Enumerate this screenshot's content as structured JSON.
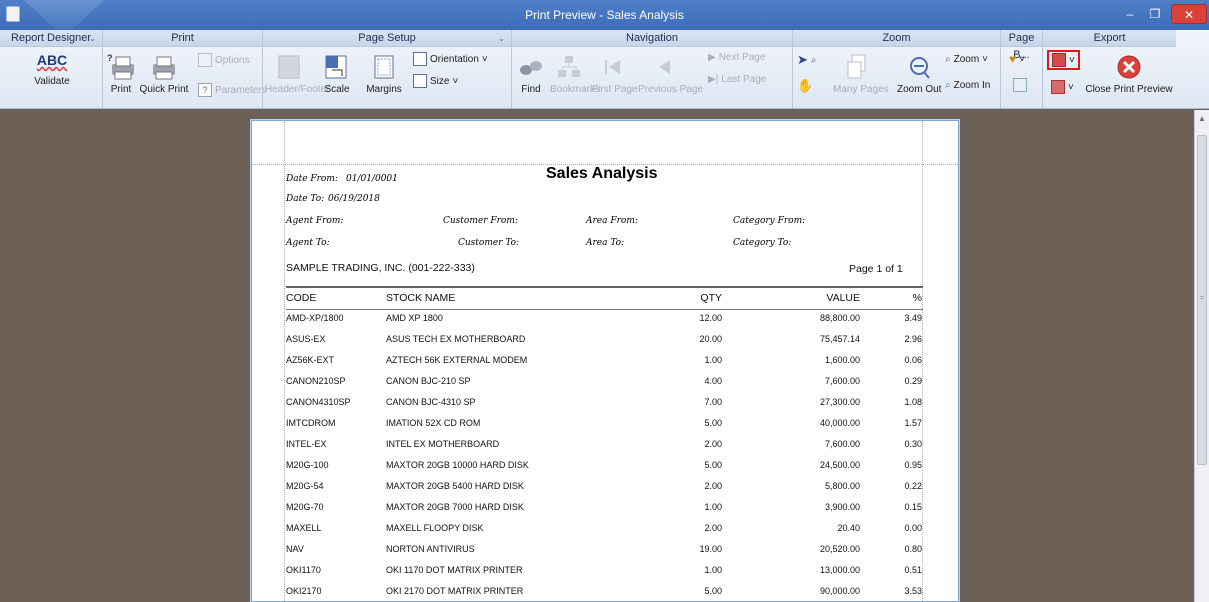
{
  "window": {
    "title": "Print Preview - Sales Analysis"
  },
  "ribbon": {
    "groups": {
      "report_designer": "Report Designer",
      "print": "Print",
      "page_setup": "Page Setup",
      "navigation": "Navigation",
      "zoom": "Zoom",
      "page_background": "Page B...",
      "export": "Export"
    },
    "validate_abc": "ABC",
    "validate": "Validate",
    "print": "Print",
    "quick_print": "Quick Print",
    "options": "Options",
    "parameters": "Parameters",
    "header_footer": "Header/Footer",
    "scale": "Scale",
    "margins": "Margins",
    "orientation": "Orientation",
    "size": "Size",
    "find": "Find",
    "bookmarks": "Bookmarks",
    "first_page": "First Page",
    "previous_page": "Previous Page",
    "next_page": "Next Page",
    "last_page": "Last Page",
    "many_pages": "Many Pages",
    "zoom_out": "Zoom Out",
    "zoom": "Zoom",
    "zoom_in": "Zoom In",
    "close_print_preview": "Close Print Preview"
  },
  "report": {
    "title": "Sales Analysis",
    "date_from_label": "Date From:",
    "date_from": "01/01/0001",
    "date_to_label": "Date To:",
    "date_to": "06/19/2018",
    "agent_from": "Agent From:",
    "agent_to": "Agent To:",
    "customer_from": "Customer From:",
    "customer_to": "Customer To:",
    "area_from": "Area From:",
    "area_to": "Area To:",
    "category_from": "Category From:",
    "category_to": "Category To:",
    "company": "SAMPLE TRADING, INC. (001-222-333)",
    "page_number": "Page 1 of 1",
    "columns": {
      "code": "CODE",
      "stock_name": "STOCK NAME",
      "qty": "QTY",
      "value": "VALUE",
      "pct": "%"
    },
    "rows": [
      {
        "code": "AMD-XP/1800",
        "name": "AMD XP 1800",
        "qty": "12.00",
        "value": "88,800.00",
        "pct": "3.49"
      },
      {
        "code": "ASUS-EX",
        "name": "ASUS TECH EX MOTHERBOARD",
        "qty": "20.00",
        "value": "75,457.14",
        "pct": "2.96"
      },
      {
        "code": "AZ56K-EXT",
        "name": "AZTECH 56K EXTERNAL MODEM",
        "qty": "1.00",
        "value": "1,600.00",
        "pct": "0.06"
      },
      {
        "code": "CANON210SP",
        "name": "CANON BJC-210 SP",
        "qty": "4.00",
        "value": "7,600.00",
        "pct": "0.29"
      },
      {
        "code": "CANON4310SP",
        "name": "CANON BJC-4310 SP",
        "qty": "7.00",
        "value": "27,300.00",
        "pct": "1.08"
      },
      {
        "code": "IMTCDROM",
        "name": "IMATION 52X CD ROM",
        "qty": "5.00",
        "value": "40,000.00",
        "pct": "1.57"
      },
      {
        "code": "INTEL-EX",
        "name": "INTEL EX MOTHERBOARD",
        "qty": "2.00",
        "value": "7,600.00",
        "pct": "0.30"
      },
      {
        "code": "M20G-100",
        "name": "MAXTOR 20GB 10000 HARD DISK",
        "qty": "5.00",
        "value": "24,500.00",
        "pct": "0.95"
      },
      {
        "code": "M20G-54",
        "name": "MAXTOR 20GB 5400 HARD DISK",
        "qty": "2.00",
        "value": "5,800.00",
        "pct": "0.22"
      },
      {
        "code": "M20G-70",
        "name": "MAXTOR 20GB 7000 HARD DISK",
        "qty": "1.00",
        "value": "3,900.00",
        "pct": "0.15"
      },
      {
        "code": "MAXELL",
        "name": "MAXELL FLOOPY DISK",
        "qty": "2.00",
        "value": "20.40",
        "pct": "0.00"
      },
      {
        "code": "NAV",
        "name": "NORTON ANTIVIRUS",
        "qty": "19.00",
        "value": "20,520.00",
        "pct": "0.80"
      },
      {
        "code": "OKI1170",
        "name": "OKI 1170 DOT MATRIX PRINTER",
        "qty": "1.00",
        "value": "13,000.00",
        "pct": "0.51"
      },
      {
        "code": "OKI2170",
        "name": "OKI 2170 DOT MATRIX PRINTER",
        "qty": "5.00",
        "value": "90,000.00",
        "pct": "3.53"
      }
    ]
  },
  "colors": {
    "titlebar": "#3d6db8",
    "workspace": "#6d6056",
    "highlight": "#e0191b",
    "close_red": "#d9413a"
  },
  "icons": {
    "min": "minimize-icon",
    "max": "maximize-icon",
    "close": "close-icon"
  }
}
